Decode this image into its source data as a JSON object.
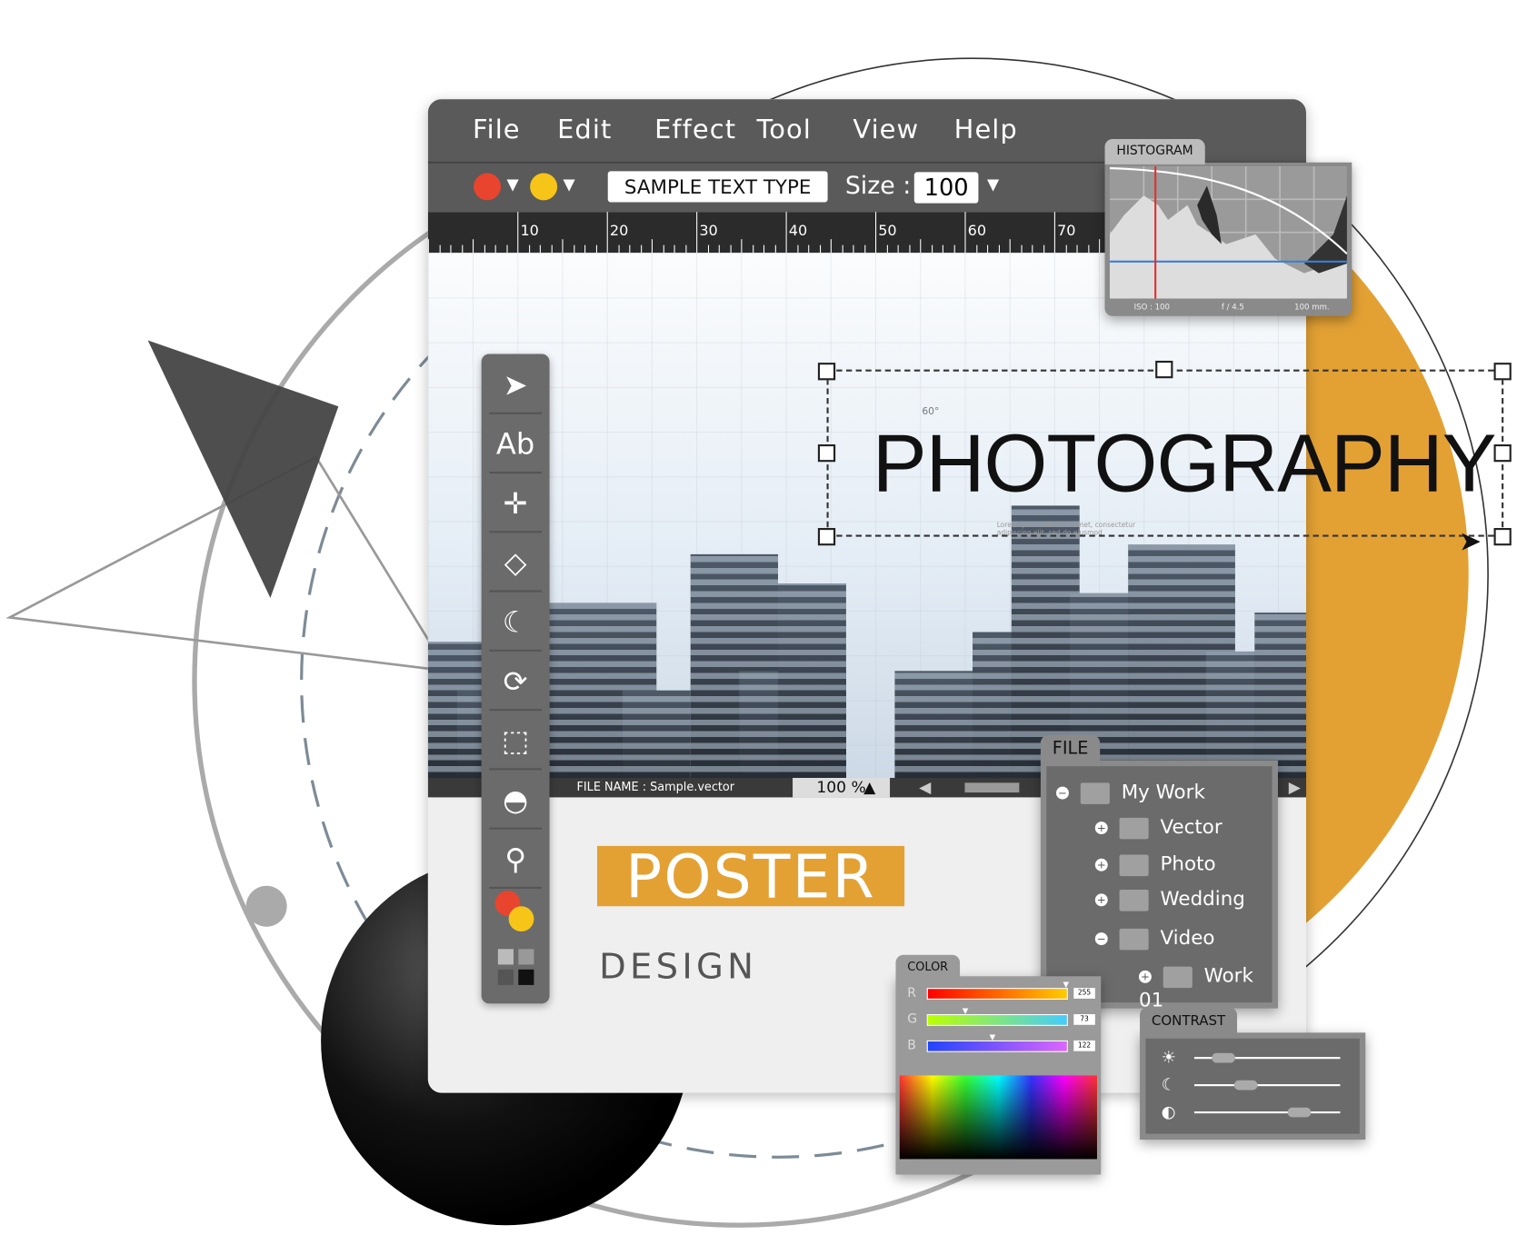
{
  "menu": [
    "File",
    "Edit",
    "Effect",
    "Tool",
    "View",
    "Help"
  ],
  "toolbar": {
    "sample_text": "SAMPLE  TEXT  TYPE",
    "size_label": "Size :",
    "size_value": "100",
    "fill_color": "#e8442e",
    "stroke_color": "#f7c518"
  },
  "ruler": [
    "10",
    "20",
    "30",
    "40",
    "50",
    "60",
    "70"
  ],
  "canvas": {
    "headline": "PHOTOGRAPHY",
    "angle": "60°",
    "caption": "Lorem ipsum dolor sit amet, consectetur adipiscing elit, sed do eiusmod"
  },
  "status": {
    "file_name": "FILE NAME  :  Sample.vector",
    "zoom": "100 %"
  },
  "tools": [
    "pointer-icon",
    "text-icon",
    "move-icon",
    "shapes-icon",
    "moon-icon",
    "rotate-icon",
    "select-icon",
    "dome-icon",
    "zoom-icon"
  ],
  "tools_text": "Ab",
  "poster": {
    "title": "POSTER",
    "subtitle": "DESIGN",
    "accent": "#e3a134"
  },
  "histogram": {
    "title": "HISTOGRAM",
    "iso": "ISO : 100",
    "aperture": "f / 4.5",
    "focal": "100 mm."
  },
  "file_panel": {
    "title": "FILE",
    "items": [
      {
        "label": "My Work",
        "state": "expanded"
      },
      {
        "label": "Vector",
        "state": "collapsed"
      },
      {
        "label": "Photo",
        "state": "collapsed"
      },
      {
        "label": "Wedding",
        "state": "collapsed"
      },
      {
        "label": "Video",
        "state": "expanded"
      },
      {
        "label": "Work 01",
        "state": "collapsed"
      }
    ]
  },
  "color_panel": {
    "title": "COLOR",
    "channels": [
      {
        "label": "R",
        "value": "255"
      },
      {
        "label": "G",
        "value": "73"
      },
      {
        "label": "B",
        "value": "122"
      }
    ]
  },
  "contrast_panel": {
    "title": "CONTRAST",
    "sliders": [
      {
        "icon": "sun-icon",
        "value": 0.2
      },
      {
        "icon": "moon-icon",
        "value": 0.35
      },
      {
        "icon": "contrast-icon",
        "value": 0.72
      }
    ]
  }
}
